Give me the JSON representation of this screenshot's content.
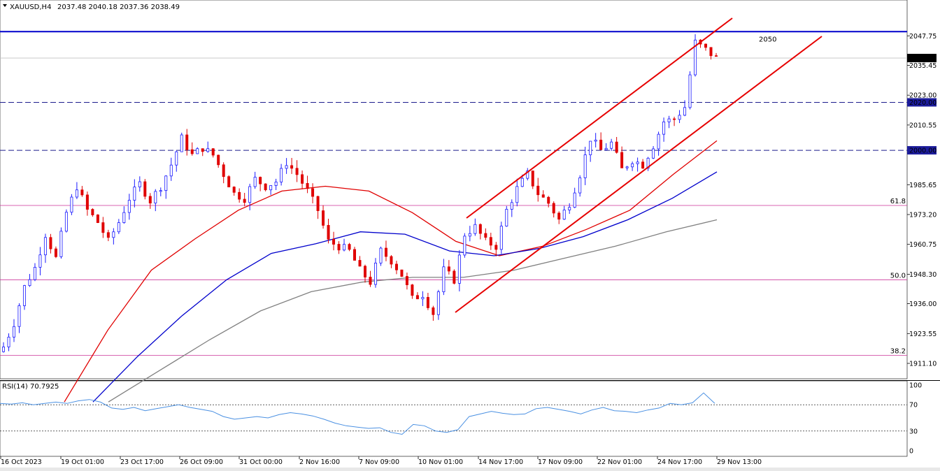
{
  "header": {
    "symbol": "XAUUSD,H4",
    "ohlc": "2037.48 2040.18 2037.36 2038.49"
  },
  "rsi_header": "RSI(14) 70.7925",
  "colors": {
    "bull": "#1a1aff",
    "bear": "#e00000",
    "ma_red": "#e00000",
    "ma_blue": "#0000cc",
    "ma_grey": "#808080",
    "fib": "#cc3399",
    "resistance": "#0000cc",
    "channel": "#e60000",
    "rsi": "#4a90e2"
  },
  "chart_data": [
    {
      "type": "candlestick",
      "symbol": "XAUUSD",
      "timeframe": "H4",
      "ylim": [
        1905,
        2055
      ],
      "y_ticks": [
        "2047.75",
        "2035.45",
        "2023.00",
        "2010.55",
        "1985.65",
        "1973.20",
        "1960.75",
        "1948.30",
        "1936.00",
        "1923.55",
        "1911.10"
      ],
      "x_ticks": [
        "16 Oct 2023",
        "19 Oct 01:00",
        "23 Oct 17:00",
        "26 Oct 09:00",
        "31 Oct 00:00",
        "2 Nov 16:00",
        "7 Nov 09:00",
        "10 Nov 01:00",
        "14 Nov 17:00",
        "17 Nov 09:00",
        "22 Nov 01:00",
        "24 Nov 17:00",
        "29 Nov 13:00"
      ],
      "close_path": [
        1918,
        1928,
        1943,
        1951,
        1965,
        1955,
        1974,
        1985,
        1975,
        1970,
        1962,
        1970,
        1980,
        1986,
        1979,
        1985,
        1994,
        2005,
        1998,
        2001,
        1998,
        1990,
        1982,
        1980,
        1988,
        1985,
        1987,
        1995,
        1990,
        1983,
        1975,
        1962,
        1960,
        1958,
        1950,
        1945,
        1958,
        1954,
        1948,
        1938,
        1940,
        1932,
        1950,
        1946,
        1965,
        1968,
        1962,
        1960,
        1975,
        1984,
        1990,
        1982,
        1978,
        1971,
        1978,
        1990,
        2005,
        2000,
        2003,
        1992,
        1996,
        1994,
        2002,
        2012,
        2013,
        2018,
        2045,
        2042,
        2038.49
      ],
      "current_price": "2038.49",
      "horizontal_levels": [
        {
          "label": "2050",
          "value": 2049.5,
          "style": "solid"
        },
        {
          "label": "2020.00",
          "value": 2020.0,
          "style": "dashed"
        },
        {
          "label": "2000.00",
          "value": 2000.0,
          "style": "dashed"
        }
      ],
      "fib_levels": [
        {
          "label": "61.8",
          "value": 1977.0
        },
        {
          "label": "50.0",
          "value": 1946.0
        },
        {
          "label": "38.2",
          "value": 1914.5
        }
      ],
      "channel_lines": [
        {
          "name": "upper",
          "from": [
            "13 Nov",
            1970
          ],
          "to": [
            "29 Nov",
            2051
          ]
        },
        {
          "name": "lower",
          "from": [
            "10 Nov 01:00",
            1931
          ],
          "to": [
            "30 Nov",
            2045
          ]
        }
      ],
      "moving_averages": [
        {
          "color": "red",
          "values": [
            1895,
            1925,
            1950,
            1963,
            1975,
            1983,
            1985,
            1983,
            1974,
            1962,
            1956,
            1960,
            1967,
            1975,
            1990,
            2004
          ]
        },
        {
          "color": "blue",
          "values": [
            1895,
            1914,
            1931,
            1946,
            1957,
            1961,
            1966,
            1965,
            1958,
            1956,
            1959,
            1964,
            1971,
            1980,
            1991
          ]
        },
        {
          "color": "grey",
          "values": [
            1895,
            1908,
            1921,
            1933,
            1941,
            1945,
            1947,
            1947,
            1950,
            1955,
            1960,
            1966,
            1971
          ]
        }
      ]
    },
    {
      "type": "line",
      "name": "RSI(14)",
      "ylim": [
        0,
        100
      ],
      "y_ticks": [
        "100",
        "70",
        "30",
        "0"
      ],
      "reference_lines": [
        70,
        30
      ],
      "values": [
        72,
        71,
        73,
        70,
        72,
        74,
        72,
        76,
        78,
        74,
        65,
        63,
        66,
        61,
        64,
        67,
        70,
        66,
        63,
        60,
        52,
        48,
        50,
        52,
        50,
        55,
        58,
        56,
        53,
        48,
        42,
        38,
        36,
        34,
        35,
        28,
        25,
        40,
        38,
        30,
        28,
        32,
        52,
        56,
        60,
        57,
        55,
        56,
        64,
        66,
        63,
        60,
        56,
        62,
        66,
        61,
        60,
        58,
        62,
        65,
        72,
        70,
        73,
        88,
        72
      ]
    }
  ]
}
